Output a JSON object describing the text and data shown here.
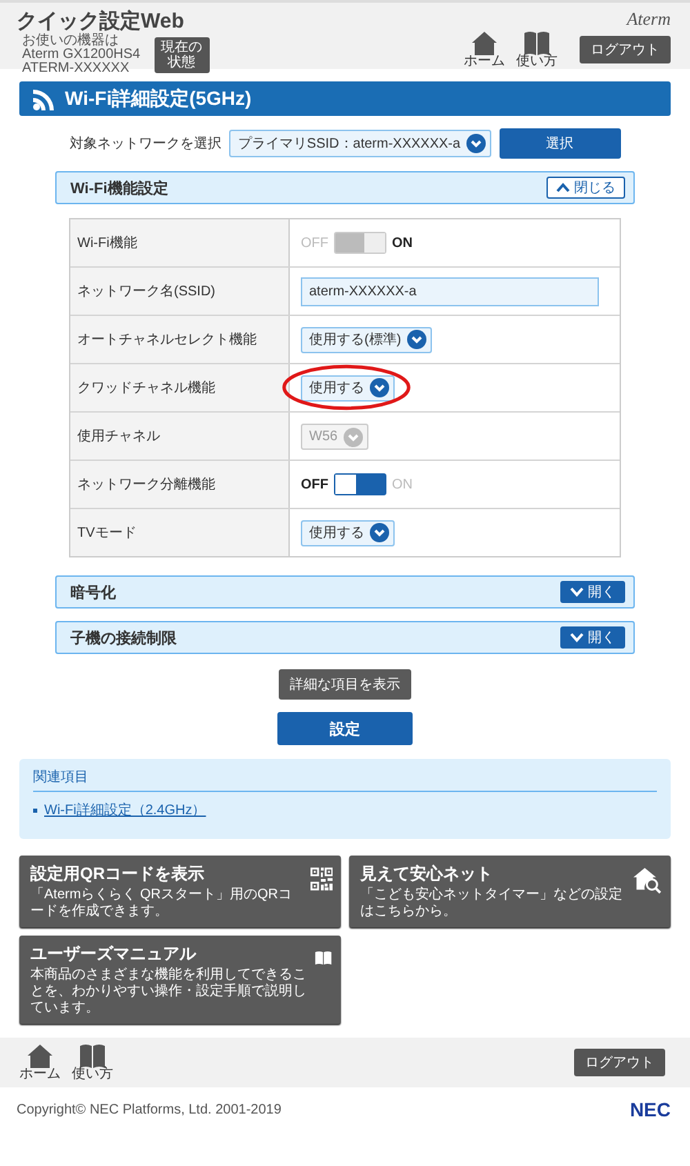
{
  "header": {
    "title": "クイック設定Web",
    "device_lines": [
      "お使いの機器は",
      "Aterm GX1200HS4",
      "ATERM-XXXXXX"
    ],
    "status_button": "現在の状態",
    "logo": "Aterm",
    "nav": [
      {
        "kind": "home",
        "label": "ホーム"
      },
      {
        "kind": "book",
        "label": "使い方"
      }
    ],
    "logout": "ログアウト"
  },
  "page_title": "Wi-Fi詳細設定(5GHz)",
  "network_select": {
    "label": "対象ネットワークを選択",
    "value": "プライマリSSID：aterm-XXXXXX-a",
    "button": "選択"
  },
  "section": {
    "title": "Wi-Fi機能設定",
    "toggle_button": "閉じる",
    "expanded": true,
    "rows": [
      {
        "label": "Wi-Fi機能",
        "kind": "toggle",
        "off_label": "OFF",
        "on_label": "ON",
        "on": true,
        "disabled": true
      },
      {
        "label": "ネットワーク名(SSID)",
        "kind": "text",
        "value": "aterm-XXXXXX-a"
      },
      {
        "label": "オートチャネルセレクト機能",
        "kind": "select",
        "value": "使用する(標準)",
        "disabled": false,
        "highlighted": false
      },
      {
        "label": "クワッドチャネル機能",
        "kind": "select",
        "value": "使用する",
        "disabled": false,
        "highlighted": true
      },
      {
        "label": "使用チャネル",
        "kind": "select",
        "value": "W56",
        "disabled": true,
        "highlighted": false
      },
      {
        "label": "ネットワーク分離機能",
        "kind": "toggle",
        "off_label": "OFF",
        "on_label": "ON",
        "on": false,
        "disabled": false
      },
      {
        "label": "TVモード",
        "kind": "select",
        "value": "使用する",
        "disabled": false,
        "highlighted": false
      }
    ]
  },
  "collapsed_sections": [
    {
      "title": "暗号化",
      "toggle_button": "開く",
      "expanded": false
    },
    {
      "title": "子機の接続制限",
      "toggle_button": "開く",
      "expanded": false
    }
  ],
  "show_details_button": "詳細な項目を表示",
  "submit_button": "設定",
  "related": {
    "title": "関連項目",
    "links": [
      "Wi-Fi詳細設定（2.4GHz）"
    ]
  },
  "cards": [
    {
      "kind": "qr",
      "title": "設定用QRコードを表示",
      "description": "「Atermらくらく QRスタート」用のQRコードを作成できます。"
    },
    {
      "kind": "house-search",
      "title": "見えて安心ネット",
      "description": "「こども安心ネットタイマー」などの設定はこちらから。"
    },
    {
      "kind": "book",
      "title": "ユーザーズマニュアル",
      "description": "本商品のさまざまな機能を利用してできることを、わかりやすい操作・設定手順で説明しています。"
    }
  ],
  "footer": {
    "nav": [
      {
        "kind": "home",
        "label": "ホーム"
      },
      {
        "kind": "book",
        "label": "使い方"
      }
    ],
    "logout": "ログアウト",
    "copyright": "Copyright© NEC Platforms, Ltd. 2001-2019",
    "brand": "NEC"
  }
}
